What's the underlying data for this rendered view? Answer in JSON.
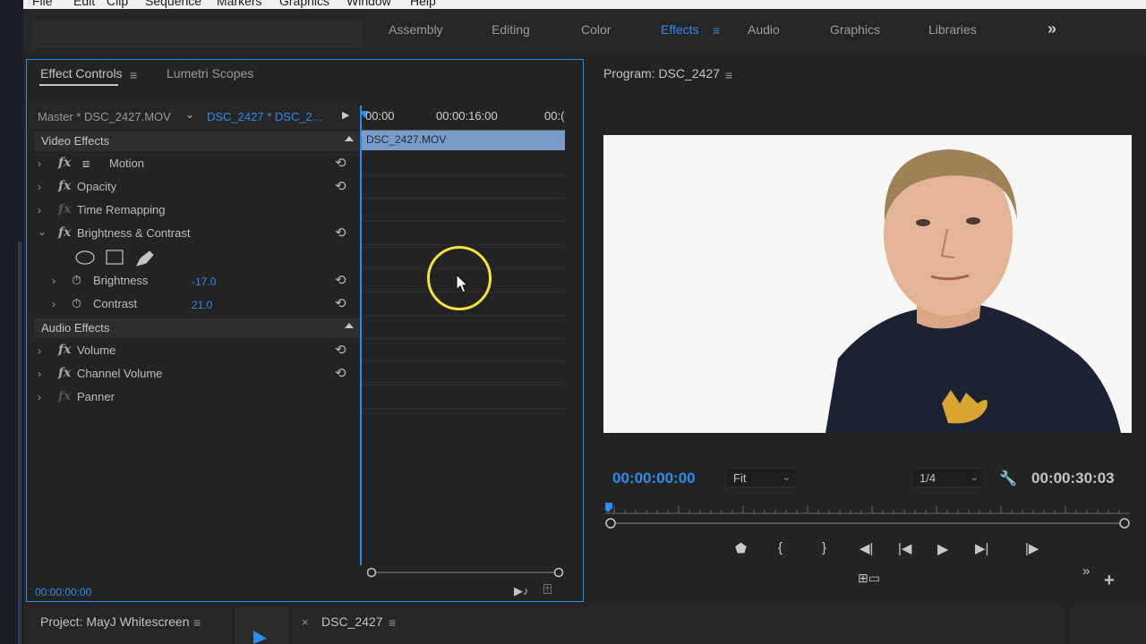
{
  "menubar": {
    "items": [
      "File",
      "Edit",
      "Clip",
      "Sequence",
      "Markers",
      "Graphics",
      "Window",
      "Help"
    ]
  },
  "workspaces": {
    "tabs": [
      "Assembly",
      "Editing",
      "Color",
      "Effects",
      "Audio",
      "Graphics",
      "Libraries"
    ],
    "active": "Effects",
    "more_icon": "double-chevron-right-icon"
  },
  "effect_controls": {
    "tab_active": "Effect Controls",
    "tab_other": "Lumetri Scopes",
    "master_label": "Master * DSC_2427.MOV",
    "sequence_label": "DSC_2427 * DSC_2...",
    "ruler": [
      "00:00",
      "00:00:16:00",
      "00:("
    ],
    "clip_name": "DSC_2427.MOV",
    "video_section": "Video Effects",
    "audio_section": "Audio Effects",
    "effects": [
      {
        "label": "Motion",
        "chevron": "›",
        "has_reset": true
      },
      {
        "label": "Opacity",
        "chevron": "›",
        "has_reset": true
      },
      {
        "label": "Time Remapping",
        "chevron": "›",
        "has_reset": false
      },
      {
        "label": "Brightness & Contrast",
        "chevron": "⌄",
        "has_reset": true
      }
    ],
    "params": [
      {
        "label": "Brightness",
        "value": "-17.0"
      },
      {
        "label": "Contrast",
        "value": "21.0"
      }
    ],
    "audio_effects": [
      {
        "label": "Volume",
        "chevron": "›"
      },
      {
        "label": "Channel Volume",
        "chevron": "›"
      },
      {
        "label": "Panner",
        "chevron": "›"
      }
    ],
    "timecode": "00:00:00:00"
  },
  "program_monitor": {
    "title": "Program: DSC_2427",
    "timecode": "00:00:00:00",
    "fit": "Fit",
    "resolution": "1/4",
    "duration": "00:00:30:03"
  },
  "bottom": {
    "project_title": "Project: MayJ Whitescreen",
    "sequence_tab": "DSC_2427",
    "close_glyph": "×"
  },
  "colors": {
    "accent": "#2d8ceb",
    "clip": "#7a9dc7",
    "cursor_ring": "#f2e23a"
  }
}
